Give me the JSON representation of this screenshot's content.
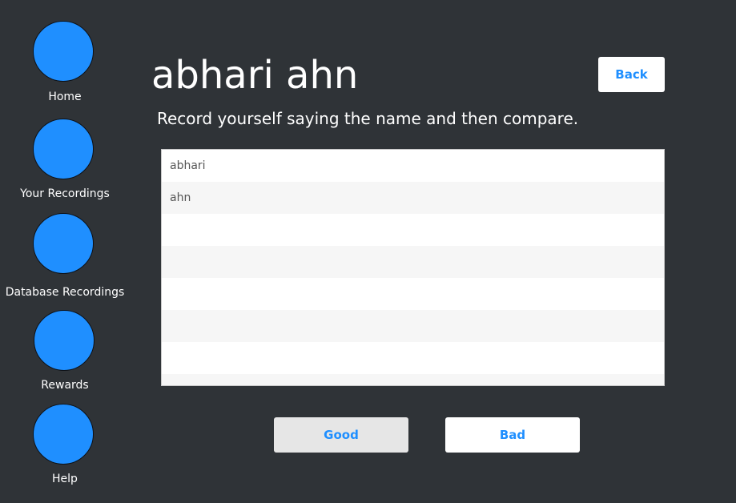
{
  "sidebar": {
    "items": [
      {
        "label": "Home"
      },
      {
        "label": "Your Recordings"
      },
      {
        "label": "Database Recordings"
      },
      {
        "label": "Rewards"
      },
      {
        "label": "Help"
      }
    ]
  },
  "header": {
    "title": "abhari ahn",
    "instruction": "Record yourself saying the name and then compare.",
    "back_label": "Back"
  },
  "list": {
    "items": [
      "abhari",
      "ahn",
      "",
      "",
      "",
      "",
      "",
      ""
    ]
  },
  "actions": {
    "good_label": "Good",
    "bad_label": "Bad"
  },
  "colors": {
    "background": "#2f3337",
    "accent": "#1f8fff"
  }
}
